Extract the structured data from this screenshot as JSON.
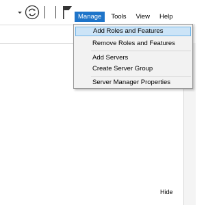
{
  "toolbar": {
    "icons": [
      "chevron-down-icon",
      "refresh-icon",
      "notifications-flag-icon"
    ]
  },
  "menubar": {
    "items": [
      {
        "label": "Manage",
        "active": true
      },
      {
        "label": "Tools"
      },
      {
        "label": "View"
      },
      {
        "label": "Help"
      }
    ]
  },
  "manage_menu": {
    "items": [
      {
        "label": "Add Roles and Features",
        "highlighted": true
      },
      {
        "label": "Remove Roles and Features"
      },
      {
        "label": "Add Servers"
      },
      {
        "label": "Create Server Group"
      },
      {
        "label": "Server Manager Properties"
      }
    ]
  },
  "panel": {
    "hide_label": "Hide"
  },
  "colors": {
    "active_menu": "#1e74c9",
    "menu_highlight": "#cce4f7",
    "menu_background": "#f2f2f2"
  }
}
